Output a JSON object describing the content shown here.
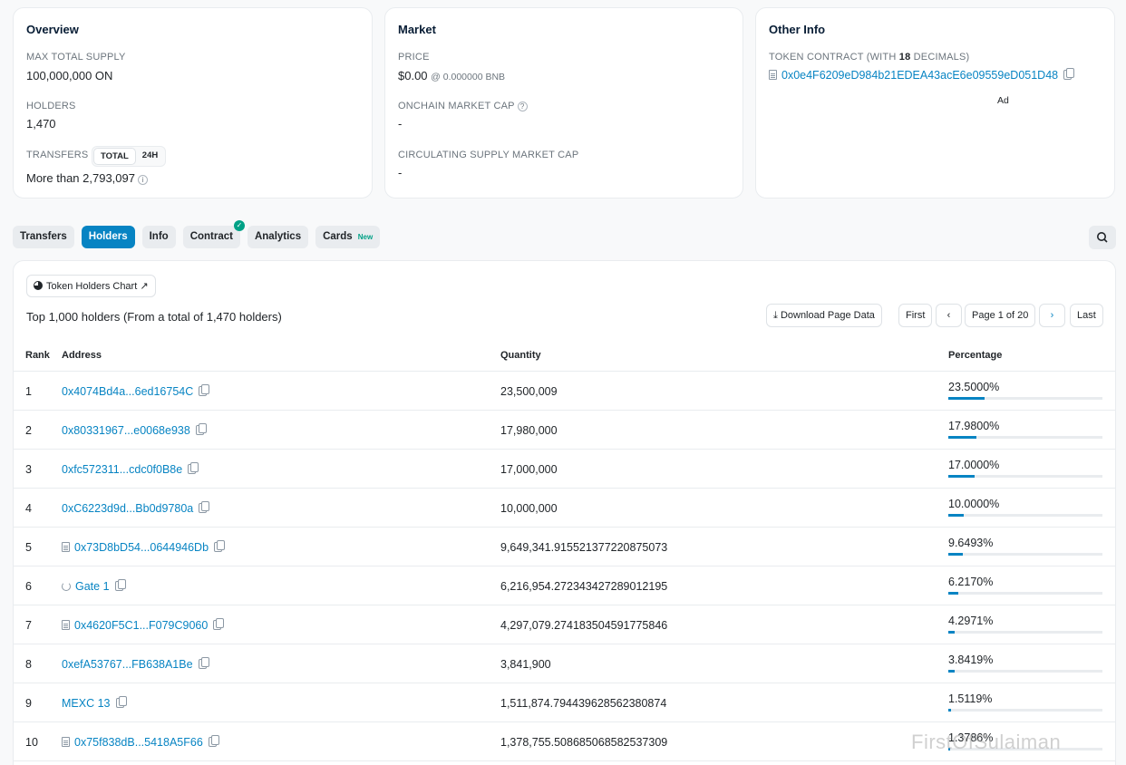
{
  "overview": {
    "title": "Overview",
    "max_supply_label": "MAX TOTAL SUPPLY",
    "max_supply_value": "100,000,000 ON",
    "holders_label": "HOLDERS",
    "holders_value": "1,470",
    "transfers_label": "TRANSFERS",
    "transfers_toggle": [
      "TOTAL",
      "24H"
    ],
    "transfers_value": "More than 2,793,097"
  },
  "market": {
    "title": "Market",
    "price_label": "PRICE",
    "price_value": "$0.00",
    "price_bnb": "@ 0.000000 BNB",
    "mcap_label": "ONCHAIN MARKET CAP",
    "mcap_value": "-",
    "circ_label": "CIRCULATING SUPPLY MARKET CAP",
    "circ_value": "-"
  },
  "other": {
    "title": "Other Info",
    "contract_label_pre": "TOKEN CONTRACT (WITH ",
    "contract_decimals": "18",
    "contract_label_post": " DECIMALS)",
    "contract_address": "0x0e4F6209eD984b21EDEA43acE6e09559eD051D48",
    "ad": "Ad"
  },
  "tabs": [
    {
      "label": "Transfers",
      "active": false
    },
    {
      "label": "Holders",
      "active": true
    },
    {
      "label": "Info",
      "active": false
    },
    {
      "label": "Contract",
      "active": false,
      "verified": true
    },
    {
      "label": "Analytics",
      "active": false
    },
    {
      "label": "Cards",
      "active": false,
      "badge": "New"
    }
  ],
  "holders": {
    "chart_button": "Token Holders Chart",
    "summary": "Top 1,000 holders (From a total of 1,470 holders)",
    "download": "Download Page Data",
    "first": "First",
    "page": "Page 1 of 20",
    "last": "Last",
    "columns": [
      "Rank",
      "Address",
      "Quantity",
      "Percentage"
    ],
    "rows": [
      {
        "rank": "1",
        "address": "0x4074Bd4a...6ed16754C",
        "icon": "none",
        "qty": "23,500,009",
        "pct": "23.5000%",
        "frac": 0.235
      },
      {
        "rank": "2",
        "address": "0x80331967...e0068e938",
        "icon": "none",
        "qty": "17,980,000",
        "pct": "17.9800%",
        "frac": 0.1798
      },
      {
        "rank": "3",
        "address": "0xfc572311...cdc0f0B8e",
        "icon": "none",
        "qty": "17,000,000",
        "pct": "17.0000%",
        "frac": 0.17
      },
      {
        "rank": "4",
        "address": "0xC6223d9d...Bb0d9780a",
        "icon": "none",
        "qty": "10,000,000",
        "pct": "10.0000%",
        "frac": 0.1
      },
      {
        "rank": "5",
        "address": "0x73D8bD54...0644946Db",
        "icon": "contract",
        "qty": "9,649,341.915521377220875073",
        "pct": "9.6493%",
        "frac": 0.096493
      },
      {
        "rank": "6",
        "address": "Gate 1",
        "icon": "exchange",
        "qty": "6,216,954.272343427289012195",
        "pct": "6.2170%",
        "frac": 0.06217
      },
      {
        "rank": "7",
        "address": "0x4620F5C1...F079C9060",
        "icon": "contract",
        "qty": "4,297,079.274183504591775846",
        "pct": "4.2971%",
        "frac": 0.042971
      },
      {
        "rank": "8",
        "address": "0xefA53767...FB638A1Be",
        "icon": "none",
        "qty": "3,841,900",
        "pct": "3.8419%",
        "frac": 0.038419
      },
      {
        "rank": "9",
        "address": "MEXC 13",
        "icon": "none",
        "qty": "1,511,874.794439628562380874",
        "pct": "1.5119%",
        "frac": 0.015119
      },
      {
        "rank": "10",
        "address": "0x75f838dB...5418A5F66",
        "icon": "contract",
        "qty": "1,378,755.508685068582537309",
        "pct": "1.3786%",
        "frac": 0.013786
      }
    ]
  },
  "watermark": "FirstOfSulaiman"
}
